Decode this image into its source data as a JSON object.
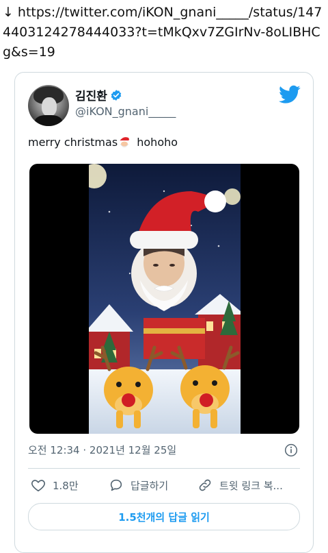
{
  "url_bar": {
    "arrow": "↓",
    "url": "https://twitter.com/iKON_gnani_____/status/1474403124278444033?t=tMkQxv7ZGIrNv-8oLIBHCg&s=19"
  },
  "tweet": {
    "display_name": "김진환",
    "handle": "@iKON_gnani_____",
    "text_before": "merry christmas",
    "text_after": " hohoho",
    "timestamp": "오전 12:34 · 2021년 12월 25일",
    "actions": {
      "like_count": "1.8만",
      "reply_label": "답글하기",
      "share_label": "트윗 링크 복..."
    },
    "read_replies": "1.5천개의 답글 읽기"
  },
  "colors": {
    "accent": "#1d9bf0",
    "text_secondary": "#536471",
    "border": "#cfd9de"
  },
  "icons": [
    "download-arrow-icon",
    "verified-badge-icon",
    "twitter-bird-icon",
    "santa-emoji-icon",
    "info-icon",
    "heart-icon",
    "reply-bubble-icon",
    "link-icon"
  ]
}
